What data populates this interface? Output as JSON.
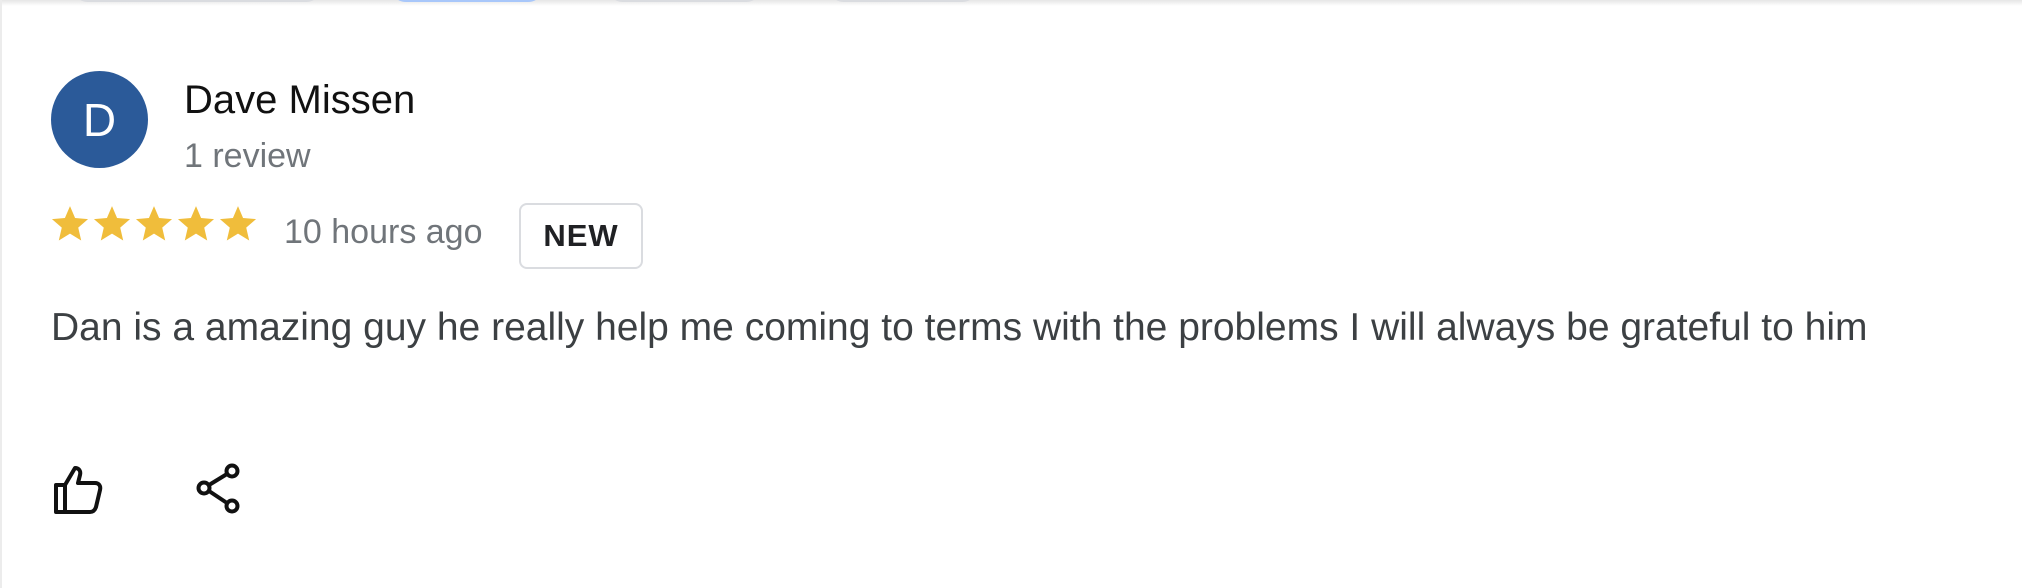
{
  "review": {
    "author": {
      "initial": "D",
      "name": "Dave Missen",
      "review_count": "1 review",
      "avatar_color": "#2b5a99"
    },
    "rating": 5,
    "rating_max": 5,
    "star_color": "#f0bd3b",
    "time_ago": "10 hours ago",
    "badge": "NEW",
    "text": "Dan is a amazing guy he really help me coming to terms with the problems I will always be grateful to him"
  },
  "actions": {
    "like_icon": "thumbs-up-icon",
    "share_icon": "share-icon"
  }
}
